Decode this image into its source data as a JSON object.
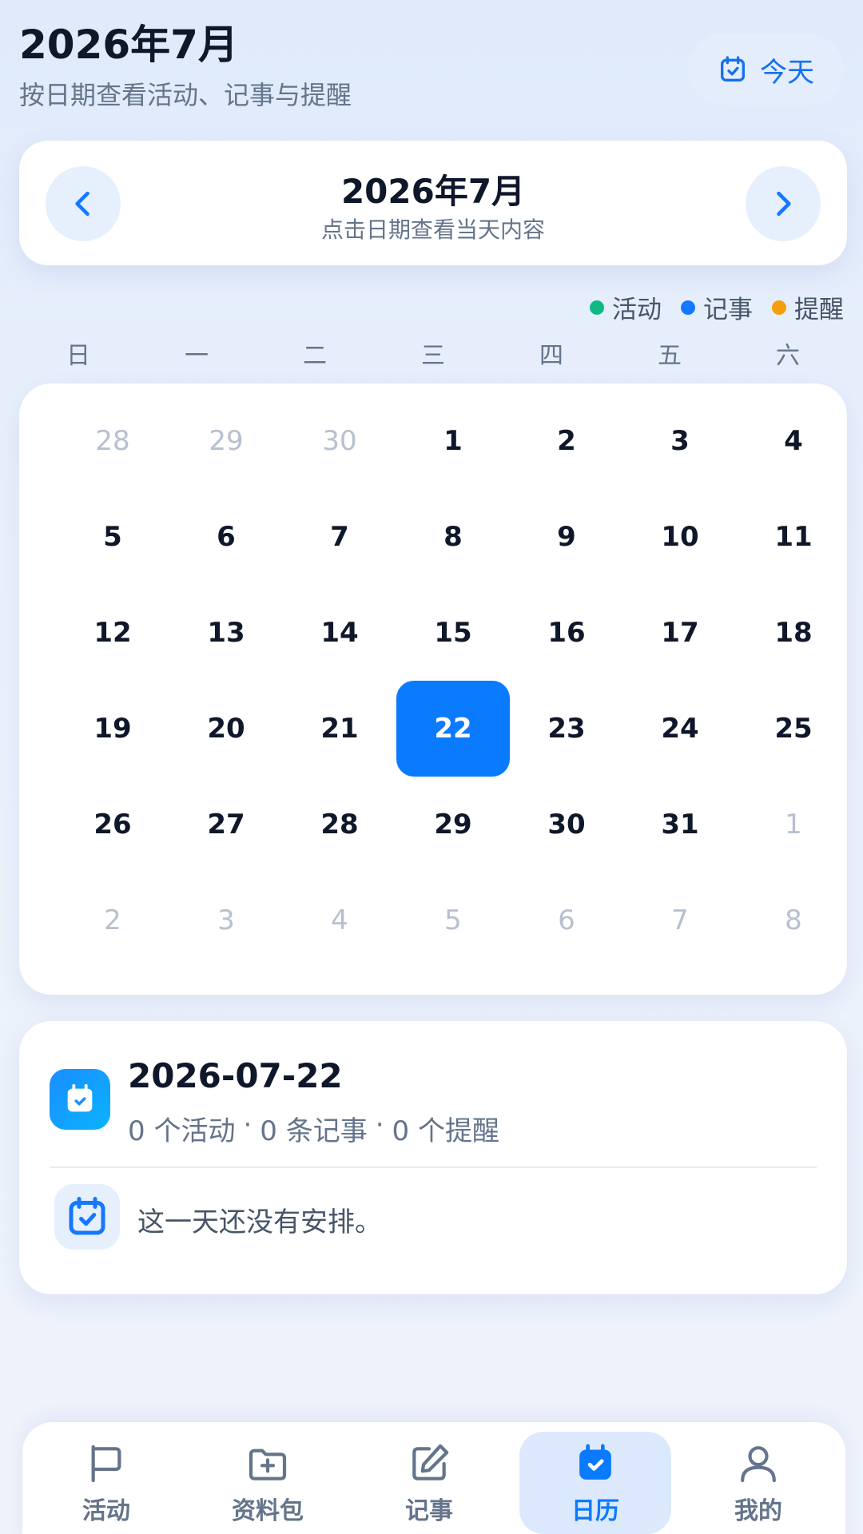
{
  "header": {
    "title": "2026年7月",
    "subtitle": "按日期查看活动、记事与提醒",
    "today_label": "今天"
  },
  "month_nav": {
    "title": "2026年7月",
    "hint": "点击日期查看当天内容"
  },
  "legend": [
    {
      "label": "活动",
      "color": "#10b981"
    },
    {
      "label": "记事",
      "color": "#1677ff"
    },
    {
      "label": "提醒",
      "color": "#f59e0b"
    }
  ],
  "weekdays": [
    "日",
    "一",
    "二",
    "三",
    "四",
    "五",
    "六"
  ],
  "calendar": {
    "selected_day": "22",
    "days": [
      {
        "label": "28",
        "muted": true
      },
      {
        "label": "29",
        "muted": true
      },
      {
        "label": "30",
        "muted": true
      },
      {
        "label": "1"
      },
      {
        "label": "2"
      },
      {
        "label": "3"
      },
      {
        "label": "4"
      },
      {
        "label": "5"
      },
      {
        "label": "6"
      },
      {
        "label": "7"
      },
      {
        "label": "8"
      },
      {
        "label": "9"
      },
      {
        "label": "10"
      },
      {
        "label": "11"
      },
      {
        "label": "12"
      },
      {
        "label": "13"
      },
      {
        "label": "14"
      },
      {
        "label": "15"
      },
      {
        "label": "16"
      },
      {
        "label": "17"
      },
      {
        "label": "18"
      },
      {
        "label": "19"
      },
      {
        "label": "20"
      },
      {
        "label": "21"
      },
      {
        "label": "22",
        "selected": true
      },
      {
        "label": "23"
      },
      {
        "label": "24"
      },
      {
        "label": "25"
      },
      {
        "label": "26"
      },
      {
        "label": "27"
      },
      {
        "label": "28"
      },
      {
        "label": "29"
      },
      {
        "label": "30"
      },
      {
        "label": "31"
      },
      {
        "label": "1",
        "muted": true
      },
      {
        "label": "2",
        "muted": true
      },
      {
        "label": "3",
        "muted": true
      },
      {
        "label": "4",
        "muted": true
      },
      {
        "label": "5",
        "muted": true
      },
      {
        "label": "6",
        "muted": true
      },
      {
        "label": "7",
        "muted": true
      },
      {
        "label": "8",
        "muted": true
      }
    ]
  },
  "detail": {
    "date": "2026-07-22",
    "activities": "0 个活动",
    "notes": "0 条记事",
    "reminders": "0 个提醒",
    "separator": "·",
    "empty_text": "这一天还没有安排。"
  },
  "bottom_nav": [
    {
      "label": "活动",
      "icon": "flag-icon"
    },
    {
      "label": "资料包",
      "icon": "folder-plus-icon"
    },
    {
      "label": "记事",
      "icon": "edit-icon"
    },
    {
      "label": "日历",
      "icon": "calendar-check-icon",
      "active": true
    },
    {
      "label": "我的",
      "icon": "user-icon"
    }
  ],
  "colors": {
    "accent": "#0a7aff",
    "muted_text": "#64748b"
  }
}
